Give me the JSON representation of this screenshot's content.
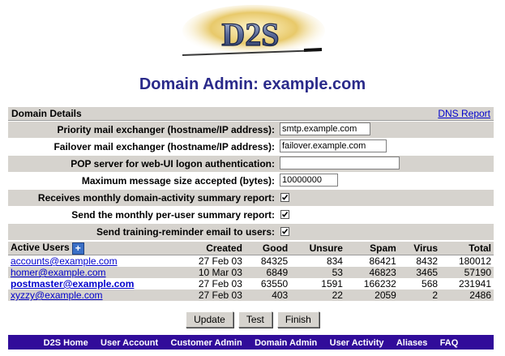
{
  "logo": {
    "text": "D2S"
  },
  "page_title": "Domain Admin: example.com",
  "domain_details": {
    "heading": "Domain Details",
    "dns_link": "DNS Report",
    "fields": [
      {
        "label": "Priority mail exchanger (hostname/IP address):",
        "value": "smtp.example.com"
      },
      {
        "label": "Failover mail exchanger (hostname/IP address):",
        "value": "failover.example.com"
      },
      {
        "label": "POP server for web-UI logon authentication:",
        "value": ""
      },
      {
        "label": "Maximum message size accepted (bytes):",
        "value": "10000000"
      }
    ],
    "checkboxes": [
      {
        "label": "Receives monthly domain-activity summary report:",
        "checked": true
      },
      {
        "label": "Send the monthly per-user summary report:",
        "checked": true
      },
      {
        "label": "Send training-reminder email to users:",
        "checked": true
      }
    ]
  },
  "users": {
    "add_icon": "plus-icon",
    "headers": [
      "Active Users",
      "Created",
      "Good",
      "Unsure",
      "Spam",
      "Virus",
      "Total"
    ],
    "rows": [
      [
        "accounts@example.com",
        "27 Feb 03",
        "84325",
        "834",
        "86421",
        "8432",
        "180012"
      ],
      [
        "homer@example.com",
        "10 Mar 03",
        "6849",
        "53",
        "46823",
        "3465",
        "57190"
      ],
      [
        "postmaster@example.com",
        "27 Feb 03",
        "63550",
        "1591",
        "166232",
        "568",
        "231941"
      ],
      [
        "xyzzy@example.com",
        "27 Feb 03",
        "403",
        "22",
        "2059",
        "2",
        "2486"
      ]
    ]
  },
  "buttons": {
    "update": "Update",
    "test": "Test",
    "finish": "Finish"
  },
  "nav": [
    "D2S Home",
    "User Account",
    "Customer Admin",
    "Domain Admin",
    "User Activity",
    "Aliases",
    "FAQ"
  ],
  "colors": {
    "title": "#2a2a8a",
    "nav_bg": "#310c9a",
    "panel_bg": "#d6d3ce",
    "link": "#0000cc"
  }
}
